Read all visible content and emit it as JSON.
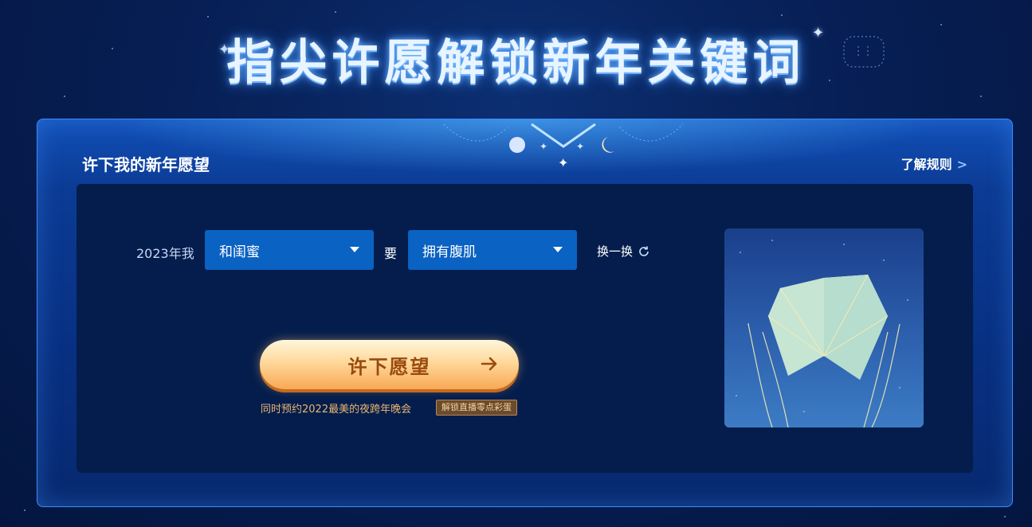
{
  "page": {
    "headline": "指尖许愿解锁新年关键词"
  },
  "panel": {
    "title": "许下我的新年愿望",
    "rules_link": "了解规则"
  },
  "form": {
    "prefix": "2023年我",
    "who_select": "和闺蜜",
    "connector": "要",
    "wish_select": "拥有腹肌",
    "shuffle": "换一换"
  },
  "cta": {
    "button": "许下愿望",
    "note": "同时预约2022最美的夜跨年晚会",
    "badge": "解锁直播零点彩蛋"
  },
  "colors": {
    "accent_blue": "#0a62c2",
    "cta_orange": "#f7a955",
    "note_gold": "#e9b570"
  },
  "icons": [
    "sparkle-icon",
    "chevron-right-icon",
    "caret-down-icon",
    "refresh-icon",
    "arrow-right-icon",
    "moon-icon"
  ]
}
